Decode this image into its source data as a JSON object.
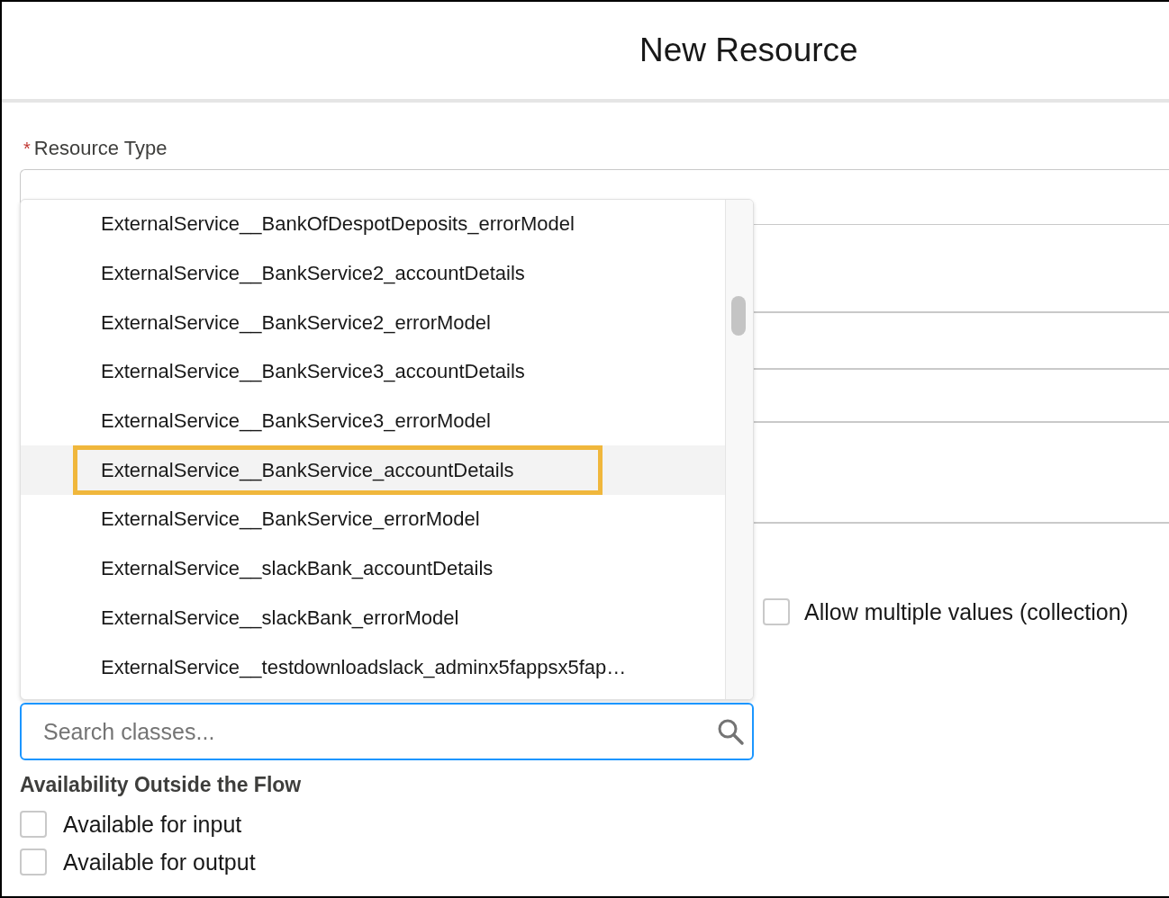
{
  "modal": {
    "title": "New Resource"
  },
  "resource_type": {
    "label": "Resource Type",
    "required_mark": "*"
  },
  "class_dropdown": {
    "items": [
      {
        "label": "ExternalService__BankOfDespotDeposits_errorModel",
        "selected": false,
        "callout": false
      },
      {
        "label": "ExternalService__BankService2_accountDetails",
        "selected": false,
        "callout": false
      },
      {
        "label": "ExternalService__BankService2_errorModel",
        "selected": false,
        "callout": false
      },
      {
        "label": "ExternalService__BankService3_accountDetails",
        "selected": false,
        "callout": false
      },
      {
        "label": "ExternalService__BankService3_errorModel",
        "selected": false,
        "callout": false
      },
      {
        "label": "ExternalService__BankService_accountDetails",
        "selected": true,
        "callout": true
      },
      {
        "label": "ExternalService__BankService_errorModel",
        "selected": false,
        "callout": false
      },
      {
        "label": "ExternalService__slackBank_accountDetails",
        "selected": false,
        "callout": false
      },
      {
        "label": "ExternalService__slackBank_errorModel",
        "selected": false,
        "callout": false
      },
      {
        "label": "ExternalService__testdownloadslack_adminx5fappsx5fap…",
        "selected": false,
        "callout": false
      }
    ],
    "search": {
      "placeholder": "Search classes..."
    }
  },
  "collection": {
    "label": "Allow multiple values (collection)",
    "checked": false
  },
  "availability": {
    "heading": "Availability Outside the Flow",
    "options": [
      {
        "label": "Available for input",
        "checked": false
      },
      {
        "label": "Available for output",
        "checked": false
      }
    ]
  }
}
